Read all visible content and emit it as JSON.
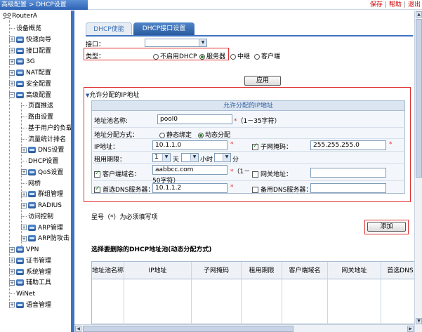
{
  "topbar": {
    "breadcrumb": "高级配置 > DHCP设置",
    "links": [
      "保存",
      "帮助",
      "退出"
    ]
  },
  "tree": {
    "root": "RouterA",
    "items": [
      {
        "label": "设备概览",
        "type": "leaf"
      },
      {
        "label": "快速向导",
        "type": "folder"
      },
      {
        "label": "接口配置",
        "type": "folder"
      },
      {
        "label": "3G",
        "type": "folder"
      },
      {
        "label": "NAT配置",
        "type": "folder"
      },
      {
        "label": "安全配置",
        "type": "folder"
      },
      {
        "label": "高级配置",
        "type": "folder-open"
      },
      {
        "label": "页面推送",
        "type": "child"
      },
      {
        "label": "路由设置",
        "type": "child"
      },
      {
        "label": "基于用户的负载",
        "type": "child"
      },
      {
        "label": "流量统计排名",
        "type": "child"
      },
      {
        "label": "DNS设置",
        "type": "child-folder"
      },
      {
        "label": "DHCP设置",
        "type": "child"
      },
      {
        "label": "QoS设置",
        "type": "child-folder"
      },
      {
        "label": "网桥",
        "type": "child"
      },
      {
        "label": "群组管理",
        "type": "child-folder"
      },
      {
        "label": "RADIUS",
        "type": "child-folder"
      },
      {
        "label": "访问控制",
        "type": "child"
      },
      {
        "label": "ARP管理",
        "type": "child-folder"
      },
      {
        "label": "ARP防攻击",
        "type": "child-folder"
      },
      {
        "label": "VPN",
        "type": "folder"
      },
      {
        "label": "证书管理",
        "type": "folder"
      },
      {
        "label": "系统管理",
        "type": "folder"
      },
      {
        "label": "辅助工具",
        "type": "folder"
      },
      {
        "label": "WiNet",
        "type": "leaf"
      },
      {
        "label": "语音管理",
        "type": "folder"
      }
    ]
  },
  "tabs": [
    "DHCP使能",
    "DHCP接口设置"
  ],
  "form": {
    "interface_label": "接口：",
    "interface_value": "",
    "type_label": "类型：",
    "type_options": [
      "不启用DHCP",
      "服务器",
      "中继",
      "客户端"
    ],
    "type_selected": 1,
    "apply_label": "应用"
  },
  "pool": {
    "section_title": "允许分配的IP地址",
    "table_title": "允许分配的IP地址",
    "name_label": "地址池名称:",
    "name_value": "pool0",
    "name_hint": "（1－35字符）",
    "mode_label": "地址分配方式：",
    "mode_options": [
      "静态绑定",
      "动态分配"
    ],
    "mode_selected": 1,
    "ip_label": "IP地址：",
    "ip_value": "10.1.1.0",
    "mask_label": "子网掩码：",
    "mask_value": "255.255.255.0",
    "lease_label": "租用期限：",
    "lease_day": "1",
    "lease_day_unit": "天",
    "lease_hour_unit": "小时",
    "lease_min_unit": "分",
    "domain_label": "客户端域名：",
    "domain_value": "aabbcc.com",
    "domain_hint_a": "（1－",
    "domain_hint_b": "50字符）",
    "gateway_label": "网关地址：",
    "gateway_value": "",
    "dns1_label": "首选DNS服务器：",
    "dns1_value": "10.1.1.2",
    "dns2_label": "备用DNS服务器：",
    "dns2_value": ""
  },
  "required_note": "星号（*）为必须填写项",
  "add_label": "添加",
  "delete_title": "选择要删除的DHCP地址池(动态分配方式)",
  "grid_headers": [
    "地址池名称",
    "IP地址",
    "子网掩码",
    "租用期限",
    "客户端域名",
    "网关地址",
    "首选DNS"
  ],
  "colors": {
    "accent": "#3e73c2",
    "highlight_box": "#e03030",
    "title_bar": "#2c63b3"
  }
}
